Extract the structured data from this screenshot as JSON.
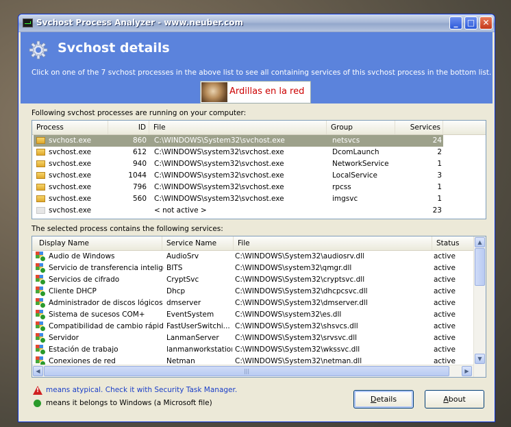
{
  "window": {
    "title": "Svchost Process Analyzer - www.neuber.com"
  },
  "header": {
    "title": "Svchost details",
    "subtitle": "Click on one of the 7 svchost processes in the above list to see all containing services of this svchost process in the bottom list.",
    "banner_text": "Ardillas en la red"
  },
  "processes": {
    "label": "Following svchost processes are running on your computer:",
    "columns": [
      "Process",
      "ID",
      "File",
      "Group",
      "Services"
    ],
    "rows": [
      [
        "svchost.exe",
        "860",
        "C:\\WINDOWS\\System32\\svchost.exe",
        "netsvcs",
        "24"
      ],
      [
        "svchost.exe",
        "612",
        "C:\\WINDOWS\\system32\\svchost.exe",
        "DcomLaunch",
        "2"
      ],
      [
        "svchost.exe",
        "940",
        "C:\\WINDOWS\\system32\\svchost.exe",
        "NetworkService",
        "1"
      ],
      [
        "svchost.exe",
        "1044",
        "C:\\WINDOWS\\system32\\svchost.exe",
        "LocalService",
        "3"
      ],
      [
        "svchost.exe",
        "796",
        "C:\\WINDOWS\\system32\\svchost.exe",
        "rpcss",
        "1"
      ],
      [
        "svchost.exe",
        "560",
        "C:\\WINDOWS\\system32\\svchost.exe",
        "imgsvc",
        "1"
      ],
      [
        "svchost.exe",
        "",
        "< not active >",
        "",
        "23"
      ]
    ],
    "selected_index": 0
  },
  "services": {
    "label": "The selected process contains the following services:",
    "columns": [
      "Display Name",
      "Service Name",
      "File",
      "Status"
    ],
    "rows": [
      [
        "Audio de Windows",
        "AudioSrv",
        "C:\\WINDOWS\\System32\\audiosrv.dll",
        "active"
      ],
      [
        "Servicio de transferencia intelige...",
        "BITS",
        "C:\\WINDOWS\\system32\\qmgr.dll",
        "active"
      ],
      [
        "Servicios de cifrado",
        "CryptSvc",
        "C:\\WINDOWS\\System32\\cryptsvc.dll",
        "active"
      ],
      [
        "Cliente DHCP",
        "Dhcp",
        "C:\\WINDOWS\\System32\\dhcpcsvc.dll",
        "active"
      ],
      [
        "Administrador de discos lógicos",
        "dmserver",
        "C:\\WINDOWS\\System32\\dmserver.dll",
        "active"
      ],
      [
        "Sistema de sucesos COM+",
        "EventSystem",
        "C:\\WINDOWS\\system32\\es.dll",
        "active"
      ],
      [
        "Compatibilidad de cambio rápido ...",
        "FastUserSwitchi...",
        "C:\\WINDOWS\\System32\\shsvcs.dll",
        "active"
      ],
      [
        "Servidor",
        "LanmanServer",
        "C:\\WINDOWS\\System32\\srvsvc.dll",
        "active"
      ],
      [
        "Estación de trabajo",
        "lanmanworkstation",
        "C:\\WINDOWS\\System32\\wkssvc.dll",
        "active"
      ],
      [
        "Conexiones de red",
        "Netman",
        "C:\\WINDOWS\\System32\\netman.dll",
        "active"
      ]
    ]
  },
  "legend": {
    "atypical": "means atypical. Check it with Security Task Manager.",
    "microsoft": "means it belongs to Windows (a Microsoft file)"
  },
  "buttons": {
    "details": "Details",
    "about": "About"
  },
  "icons": {
    "process": "folder-icon",
    "service": "windows-service-icon",
    "warning": "warning-icon",
    "check": "check-icon"
  }
}
